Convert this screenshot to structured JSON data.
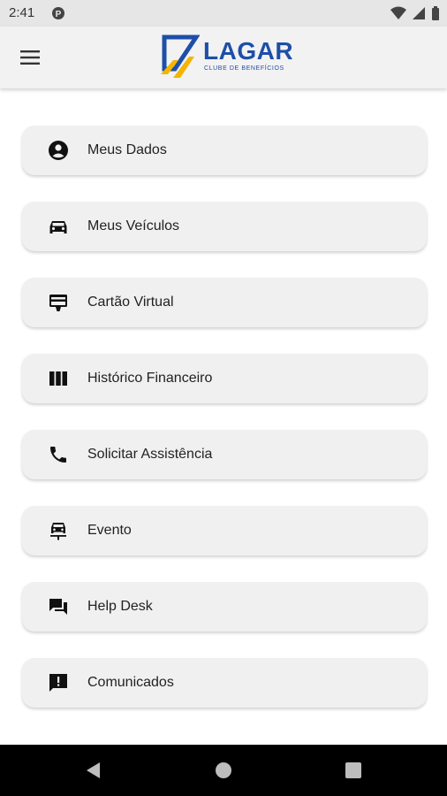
{
  "status_bar": {
    "time": "2:41",
    "icons": [
      "p-notification-icon",
      "wifi-icon",
      "signal-icon",
      "battery-icon"
    ]
  },
  "app_bar": {
    "menu_icon": "hamburger-menu-icon",
    "logo": {
      "name": "LAGAR",
      "tagline": "CLUBE DE BENEFÍCIOS"
    },
    "colors": {
      "logo_blue": "#1e4fa8",
      "logo_orange": "#f5b400",
      "background": "#f2f2f2"
    }
  },
  "menu": {
    "items": [
      {
        "label": "Meus Dados",
        "icon": "account-circle-icon"
      },
      {
        "label": "Meus Veículos",
        "icon": "car-icon"
      },
      {
        "label": "Cartão Virtual",
        "icon": "card-monitor-icon"
      },
      {
        "label": "Histórico Financeiro",
        "icon": "columns-icon"
      },
      {
        "label": "Solicitar Assistência",
        "icon": "phone-icon"
      },
      {
        "label": "Evento",
        "icon": "car-accident-icon"
      },
      {
        "label": "Help Desk",
        "icon": "forum-icon"
      },
      {
        "label": "Comunicados",
        "icon": "announcement-icon"
      }
    ],
    "colors": {
      "item_background": "#f0f0f0",
      "text": "#222222"
    }
  },
  "nav_bar": {
    "buttons": [
      "back-icon",
      "home-icon",
      "recents-icon"
    ]
  }
}
